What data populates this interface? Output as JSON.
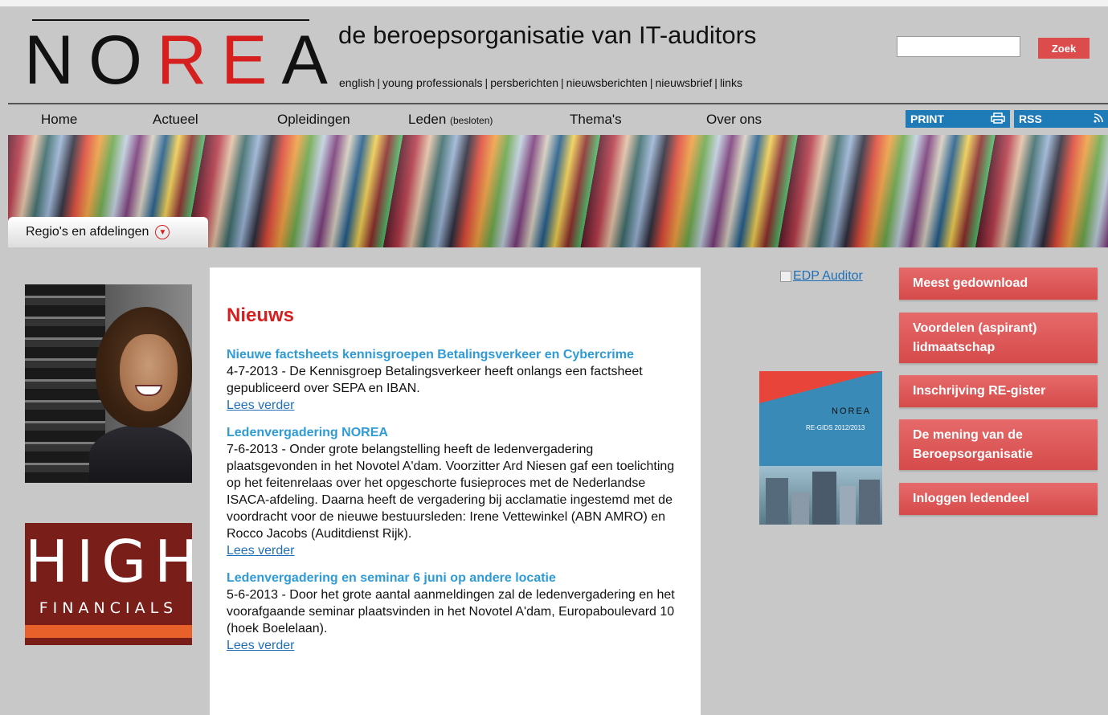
{
  "header": {
    "logo_text": "NOREA",
    "tagline": "de beroepsorganisatie van IT-auditors",
    "top_links": [
      "english",
      "young professionals",
      "persberichten",
      "nieuwsberichten",
      "nieuwsbrief",
      "links"
    ],
    "search": {
      "placeholder": "",
      "button_label": "Zoek"
    }
  },
  "nav": {
    "items": [
      "Home",
      "Actueel",
      "Opleidingen",
      "Leden",
      "Thema's",
      "Over ons"
    ],
    "leden_suffix": "(besloten)",
    "print_label": "PRINT",
    "rss_label": "RSS"
  },
  "banner": {
    "regio_label": "Regio's en afdelingen"
  },
  "left": {
    "ad_high": "HIGH",
    "ad_financials": "FINANCIALS"
  },
  "news": {
    "heading": "Nieuws",
    "items": [
      {
        "title": "Nieuwe factsheets kennisgroepen Betalingsverkeer en Cybercrime",
        "text": "4-7-2013 - De Kennisgroep Betalingsverkeer heeft onlangs een factsheet gepubliceerd over SEPA en IBAN.",
        "more": "Lees verder"
      },
      {
        "title": "Ledenvergadering NOREA",
        "text": "7-6-2013 - Onder grote belangstelling heeft de ledenvergadering plaatsgevonden in het Novotel A'dam. Voorzitter Ard Niesen gaf een toelichting op het feitenrelaas over het opgeschorte fusieproces met de Nederlandse ISACA-afdeling. Daarna heeft de vergadering bij acclamatie ingestemd met de voordracht voor de nieuwe bestuursleden: Irene Vettewinkel (ABN AMRO) en Rocco Jacobs (Auditdienst Rijk).",
        "more": "Lees verder"
      },
      {
        "title": "Ledenvergadering en seminar 6 juni op andere locatie",
        "text": "5-6-2013 - Door het grote aantal aanmeldingen zal de ledenvergadering en het voorafgaande seminar plaatsvinden in het Novotel A'dam, Europaboulevard 10 (hoek Boelelaan).",
        "more": "Lees verder"
      }
    ]
  },
  "right": {
    "edp_alt": "EDP Auditor",
    "regids_logo": "NOREA",
    "regids_title": "RE-GIDS 2012/2013",
    "buttons": [
      "Meest gedownload",
      "Voordelen (aspirant) lidmaatschap",
      "Inschrijving RE-gister",
      "De mening van de Beroepsorganisatie",
      "Inloggen ledendeel"
    ]
  }
}
